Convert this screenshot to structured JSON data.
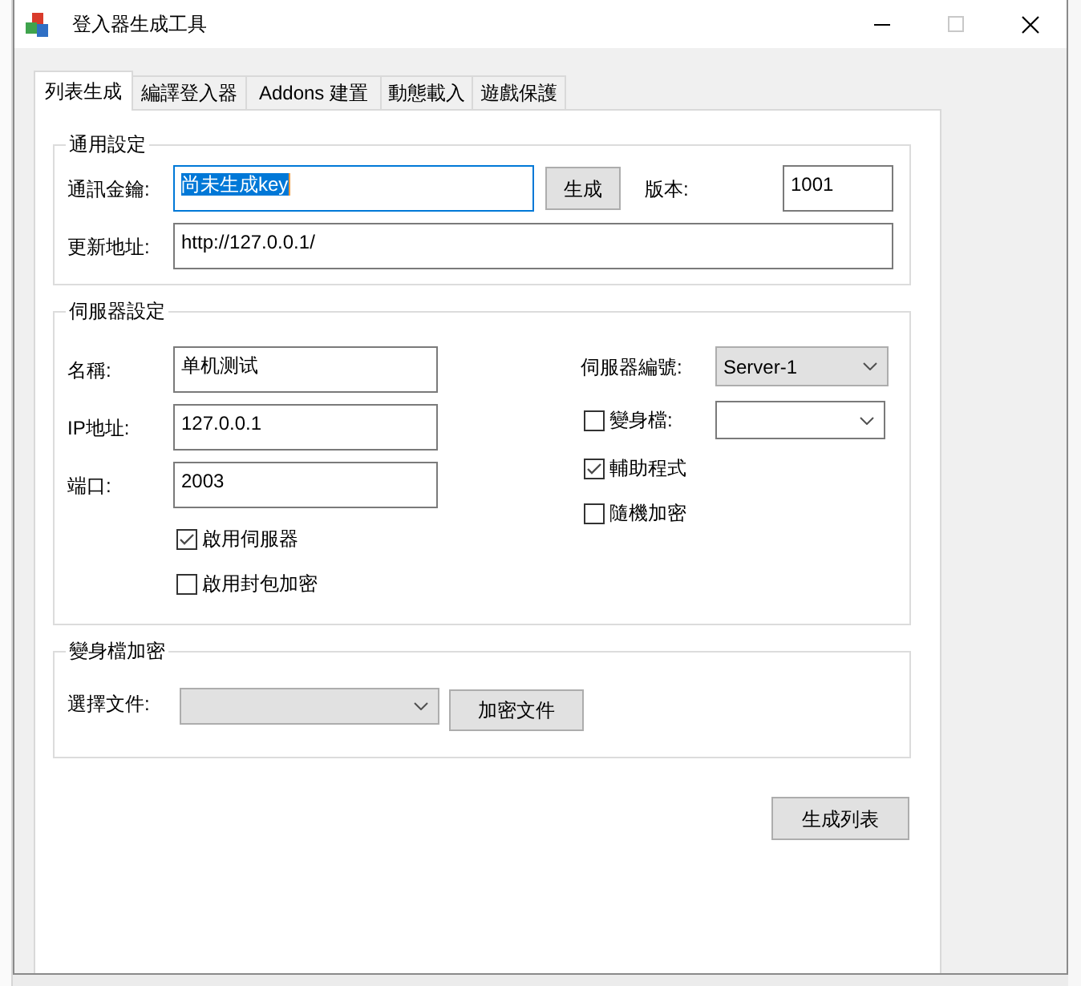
{
  "window": {
    "title": "登入器生成工具",
    "maximize_enabled": false
  },
  "tabs": [
    {
      "label": "列表生成",
      "selected": true
    },
    {
      "label": "編譯登入器",
      "selected": false
    },
    {
      "label": "Addons 建置",
      "selected": false
    },
    {
      "label": "動態載入",
      "selected": false
    },
    {
      "label": "遊戲保護",
      "selected": false
    }
  ],
  "general_settings": {
    "title": "通用設定",
    "key": {
      "label": "通訊金鑰:",
      "value": "尚未生成key",
      "focused": true,
      "text_selected": true
    },
    "generate_button": "生成",
    "version": {
      "label": "版本:",
      "value": "1001"
    },
    "update_url": {
      "label": "更新地址:",
      "value": "http://127.0.0.1/"
    }
  },
  "server_settings": {
    "title": "伺服器設定",
    "fields": [
      {
        "label": "名稱:",
        "value": "单机测试"
      },
      {
        "label": "IP地址:",
        "value": "127.0.0.1"
      },
      {
        "label": "端口:",
        "value": "2003"
      }
    ],
    "options": [
      {
        "label": "啟用伺服器",
        "checked": true
      },
      {
        "label": "啟用封包加密",
        "checked": false
      }
    ],
    "server_number": {
      "label": "伺服器編號:",
      "value": "Server-1",
      "editable": false
    },
    "right_options": [
      {
        "kind": "checkbox_combo",
        "label": "變身檔:",
        "checked": false,
        "combo": {
          "editable": true
        }
      },
      {
        "kind": "checkbox",
        "label": "輔助程式",
        "checked": true
      },
      {
        "kind": "checkbox",
        "label": "隨機加密",
        "checked": false
      }
    ]
  },
  "transform_encryption": {
    "title": "變身檔加密",
    "file": {
      "label": "選擇文件:",
      "editable": false
    },
    "encrypt_button": "加密文件"
  },
  "generate_list_button": "生成列表"
}
